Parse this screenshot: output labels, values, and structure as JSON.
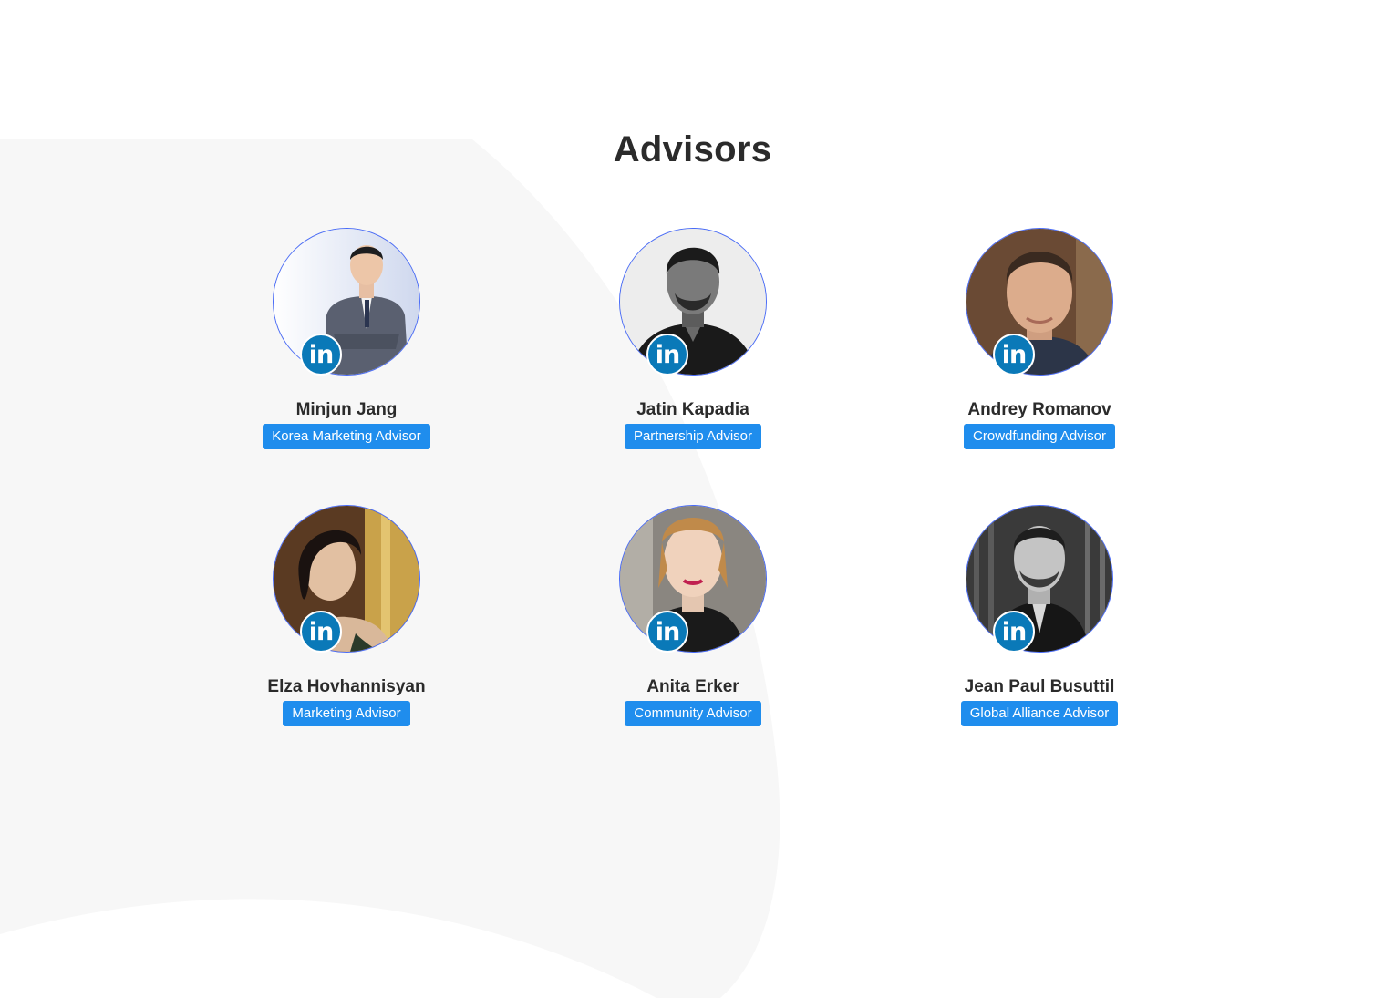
{
  "section": {
    "title": "Advisors"
  },
  "advisors": [
    {
      "name": "Minjun Jang",
      "role": "Korea Marketing Advisor"
    },
    {
      "name": "Jatin Kapadia",
      "role": "Partnership Advisor"
    },
    {
      "name": "Andrey Romanov",
      "role": "Crowdfunding Advisor"
    },
    {
      "name": "Elza Hovhannisyan",
      "role": "Marketing Advisor"
    },
    {
      "name": "Anita Erker",
      "role": "Community Advisor"
    },
    {
      "name": "Jean Paul Busuttil",
      "role": "Global Alliance Advisor"
    }
  ],
  "linkedin_badge": {
    "text": "in",
    "icon": "linkedin-icon",
    "color": "#0a79b8"
  },
  "colors": {
    "role_badge": "#1f8ded",
    "avatar_border": "#4a6cf7",
    "background_shape": "#f7f7f7",
    "heading": "#2b2b2b"
  }
}
